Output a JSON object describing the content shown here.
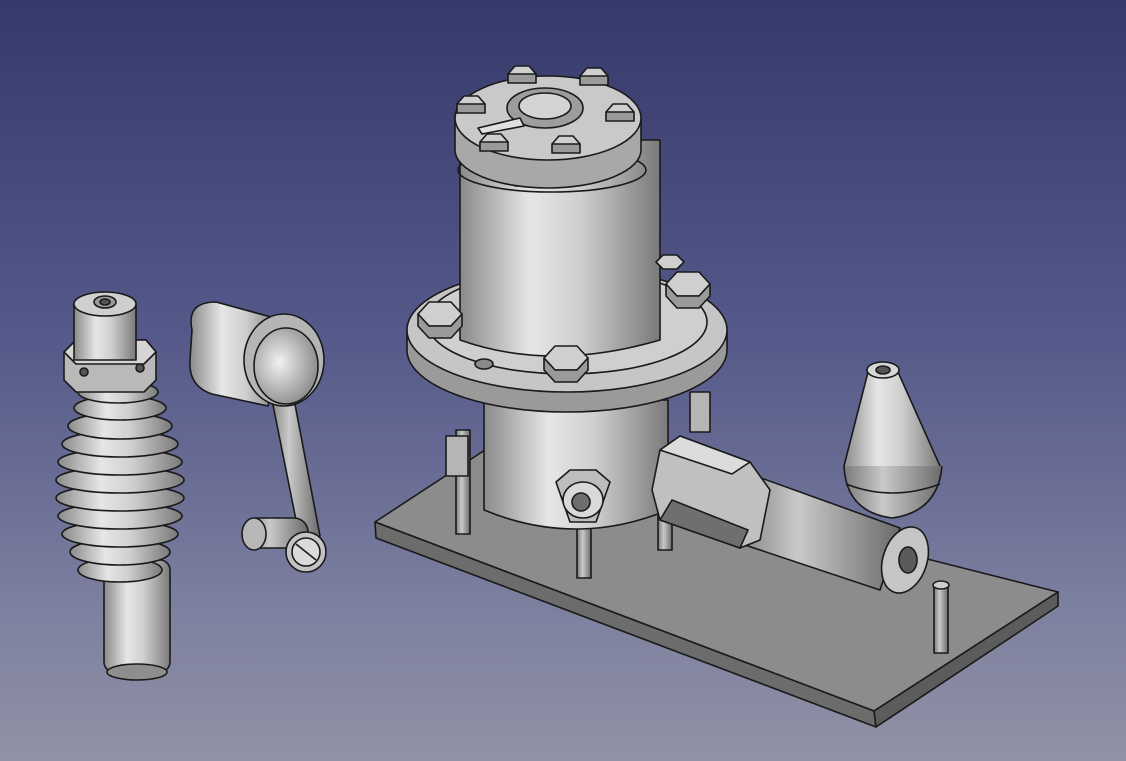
{
  "app": "FreeCAD 3D view",
  "viewport": {
    "background_top": "#363a6b",
    "background_bottom": "#9192a6",
    "render_mode": "flat-lines",
    "part_color": "#c8c8c8",
    "edge_color": "#1a1a1a"
  },
  "parts": [
    "spring-piston",
    "crank-arm",
    "engine-assembly",
    "base-plate",
    "cone-weight"
  ]
}
